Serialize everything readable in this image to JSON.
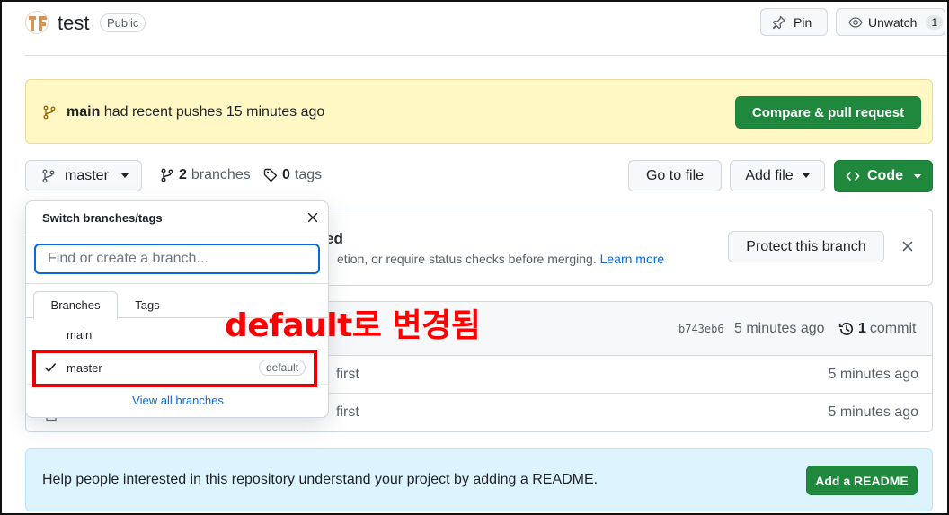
{
  "repo": {
    "name": "test",
    "visibility": "Public",
    "pin_label": "Pin",
    "watch_label": "Unwatch",
    "watch_count": "1"
  },
  "push_banner": {
    "branch": "main",
    "message": "had recent pushes 15 minutes ago",
    "button": "Compare & pull request"
  },
  "branch_bar": {
    "current_branch": "master",
    "branch_count": "2",
    "branch_word": "branches",
    "tag_count": "0",
    "tag_word": "tags",
    "go_to_file": "Go to file",
    "add_file": "Add file",
    "code": "Code"
  },
  "protect_banner": {
    "title_fragment": "ed",
    "desc_fragment": "etion, or require status checks before merging.",
    "learn_more": "Learn more",
    "button": "Protect this branch"
  },
  "commits": {
    "sha": "b743eb6",
    "time": "5 minutes ago",
    "count": "1",
    "count_word": "commit",
    "rows": [
      {
        "message": "first",
        "age": "5 minutes ago"
      },
      {
        "message": "first",
        "age": "5 minutes ago"
      }
    ]
  },
  "readme_banner": {
    "text": "Help people interested in this repository understand your project by adding a README.",
    "button": "Add a README"
  },
  "branch_dropdown": {
    "title": "Switch branches/tags",
    "search_placeholder": "Find or create a branch...",
    "tabs": [
      "Branches",
      "Tags"
    ],
    "items": [
      {
        "name": "main",
        "checked": false,
        "badge": ""
      },
      {
        "name": "master",
        "checked": true,
        "badge": "default"
      }
    ],
    "view_all": "View all branches"
  },
  "annotation": {
    "text": "default로 변경됨",
    "color": "#ff0000"
  },
  "colors": {
    "primary_green": "#1f883d",
    "link_blue": "#0969da",
    "warning_bg": "#fff8c5",
    "info_bg": "#ddf4ff"
  }
}
